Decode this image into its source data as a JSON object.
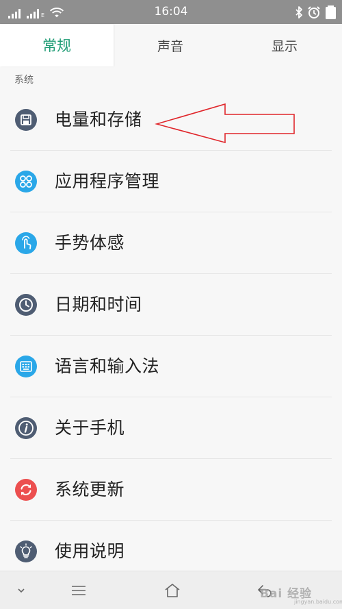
{
  "status_bar": {
    "time": "16:04",
    "signal_1": {
      "icon": "cellular-signal-icon",
      "tag": ""
    },
    "signal_2": {
      "icon": "cellular-signal-icon",
      "tag": "E"
    },
    "icons": [
      "wifi-icon",
      "bluetooth-icon",
      "alarm-icon",
      "battery-icon"
    ]
  },
  "tabs": [
    {
      "label": "常规",
      "active": true
    },
    {
      "label": "声音",
      "active": false
    },
    {
      "label": "显示",
      "active": false
    }
  ],
  "section": {
    "title": "系统"
  },
  "items": [
    {
      "label": "电量和存储",
      "icon": "storage-icon",
      "color": "#4f5d73"
    },
    {
      "label": "应用程序管理",
      "icon": "apps-icon",
      "color": "#2aa7e8"
    },
    {
      "label": "手势体感",
      "icon": "gesture-icon",
      "color": "#2aa7e8"
    },
    {
      "label": "日期和时间",
      "icon": "clock-icon",
      "color": "#4f5d73"
    },
    {
      "label": "语言和输入法",
      "icon": "keyboard-icon",
      "color": "#2aa7e8"
    },
    {
      "label": "关于手机",
      "icon": "info-icon",
      "color": "#4f5d73"
    },
    {
      "label": "系统更新",
      "icon": "update-icon",
      "color": "#ec4f4f"
    },
    {
      "label": "使用说明",
      "icon": "lightbulb-icon",
      "color": "#4f5d73"
    }
  ],
  "annotation": {
    "icon": "red-arrow-annotation",
    "color": "#e0262b"
  },
  "nav_bar": {
    "buttons": [
      "chevron-down-icon",
      "menu-icon",
      "home-icon",
      "back-icon"
    ]
  },
  "watermark": {
    "text": "Bai 经验",
    "sub": "jingyan.baidu.com"
  }
}
